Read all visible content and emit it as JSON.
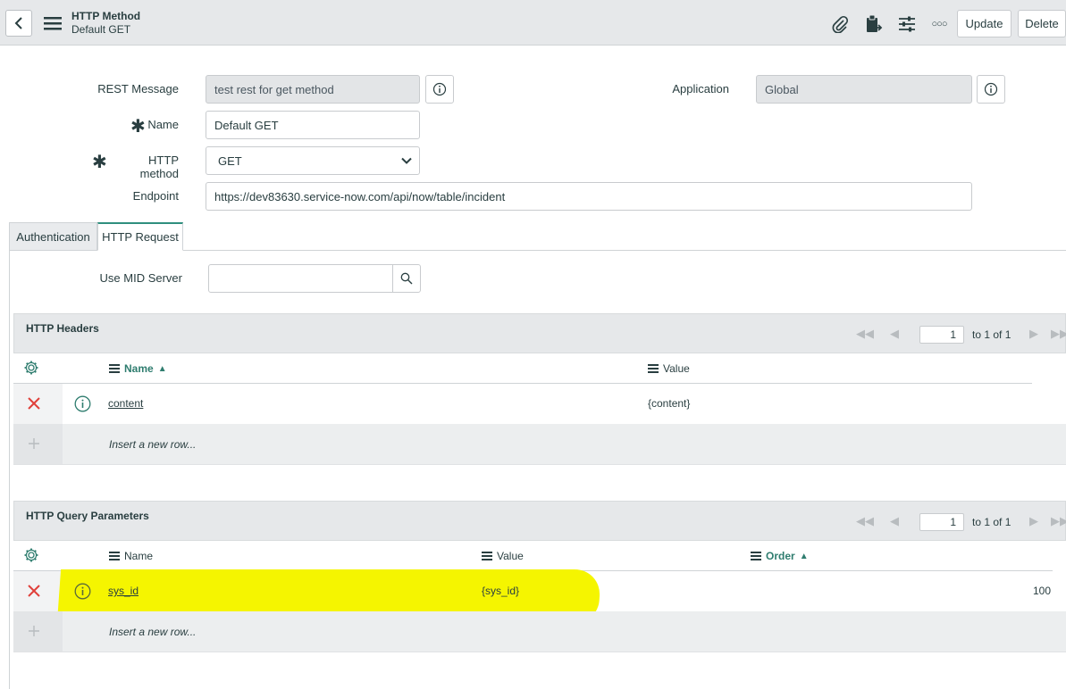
{
  "header": {
    "title": "HTTP Method",
    "subtitle": "Default GET",
    "update_label": "Update",
    "delete_label": "Delete",
    "more_label": "○○○"
  },
  "form": {
    "rest_message_label": "REST Message",
    "rest_message_value": "test rest for get method",
    "application_label": "Application",
    "application_value": "Global",
    "name_label": "Name",
    "name_value": "Default GET",
    "http_method_label": "HTTP method",
    "http_method_value": "GET",
    "endpoint_label": "Endpoint",
    "endpoint_value": "https://dev83630.service-now.com/api/now/table/incident"
  },
  "tabs": [
    {
      "label": "Authentication"
    },
    {
      "label": "HTTP Request"
    }
  ],
  "mid_server": {
    "label": "Use MID Server",
    "value": ""
  },
  "headers_list": {
    "title": "HTTP Headers",
    "page": "1",
    "page_text": "to 1 of 1",
    "columns": [
      "Name",
      "Value"
    ],
    "sort_indicator": "▲",
    "rows": [
      {
        "name": "content",
        "value": "{content}"
      }
    ],
    "insert_text": "Insert a new row..."
  },
  "params_list": {
    "title": "HTTP Query Parameters",
    "page": "1",
    "page_text": "to 1 of 1",
    "columns": [
      "Name",
      "Value",
      "Order"
    ],
    "sort_indicator": "▲",
    "rows": [
      {
        "name": "sys_id",
        "value": "{sys_id}",
        "order": "100"
      }
    ],
    "insert_text": "Insert a new row..."
  },
  "colors": {
    "accent": "#2f8f7e",
    "delete_x": "#e0403a",
    "highlight": "#f5f500"
  }
}
